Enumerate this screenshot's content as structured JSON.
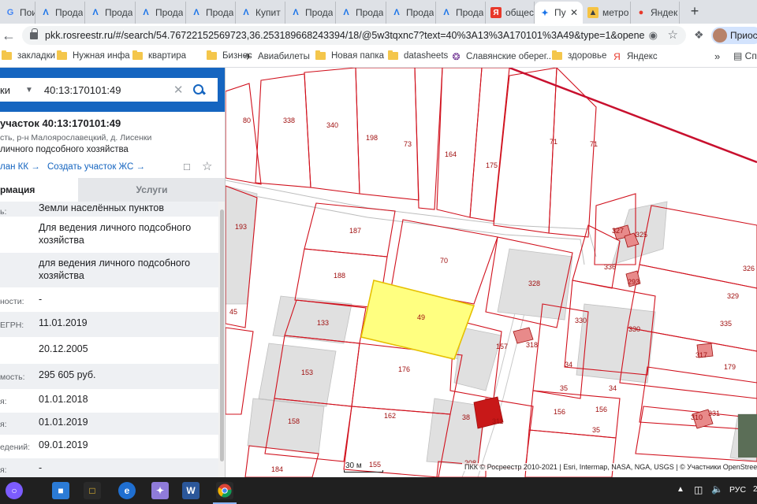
{
  "browser": {
    "tabs": [
      {
        "label": "Поиск",
        "favicon": "google-icon",
        "active": false
      },
      {
        "label": "Прода",
        "favicon": "rosreestr-icon",
        "active": false
      },
      {
        "label": "Прода",
        "favicon": "rosreestr-icon",
        "active": false
      },
      {
        "label": "Прода",
        "favicon": "rosreestr-icon",
        "active": false
      },
      {
        "label": "Прода",
        "favicon": "rosreestr-icon",
        "active": false
      },
      {
        "label": "Купит",
        "favicon": "rosreestr-icon",
        "active": false
      },
      {
        "label": "Прода",
        "favicon": "rosreestr-icon",
        "active": false
      },
      {
        "label": "Прода",
        "favicon": "rosreestr-icon",
        "active": false
      },
      {
        "label": "Прода",
        "favicon": "rosreestr-icon",
        "active": false
      },
      {
        "label": "Прода",
        "favicon": "rosreestr-icon",
        "active": false
      },
      {
        "label": "общес",
        "favicon": "yandex-icon",
        "active": false
      },
      {
        "label": "Пу",
        "favicon": "pkk-icon",
        "active": true
      },
      {
        "label": "метро",
        "favicon": "image-icon",
        "active": false
      },
      {
        "label": "Яндек",
        "favicon": "maps-pin-icon",
        "active": false
      }
    ],
    "new_tab": "+",
    "url_host": "pkk.rosreestr.ru",
    "url_rest": "/#/search/54.76722152569723,36.253189668243394/18/@5w3tqxnc7?text=40%3A13%3A170101%3A49&type=1&opened=40%...",
    "profile_label": "Приос",
    "bookmarks": [
      {
        "label": "закладки",
        "icon": "folder-icon"
      },
      {
        "label": "Нужная инфа",
        "icon": "folder-icon"
      },
      {
        "label": "квартира",
        "icon": "folder-icon"
      },
      {
        "label": "Бизнес",
        "icon": "folder-icon"
      },
      {
        "label": "Авиабилеты",
        "icon": "plane-icon"
      },
      {
        "label": "Новая папка",
        "icon": "folder-icon"
      },
      {
        "label": "datasheets",
        "icon": "folder-icon"
      },
      {
        "label": "Славянские оберег...",
        "icon": "slavic-icon"
      },
      {
        "label": "здоровье",
        "icon": "folder-icon"
      },
      {
        "label": "Яндекс",
        "icon": "yandex-icon"
      }
    ],
    "bookmarks_more": "»",
    "bookmarks_reading_list": "Сп"
  },
  "panel": {
    "search_type": "ки",
    "search_value": "40:13:170101:49",
    "title": "участок 40:13:170101:49",
    "address": "сть, р-н Малоярославецкий, д. Лисенки",
    "use": "личного подсобного хозяйства",
    "link_plan": "лан КК →",
    "link_create": "Создать участок ЖС →",
    "tab_info": "рмация",
    "tab_services": "Услуги",
    "rows": [
      {
        "key": "ь:",
        "value": "Земли населённых пунктов"
      },
      {
        "key": "",
        "value": "Для ведения личного подсобного хозяйства"
      },
      {
        "key": "",
        "value": "для ведения личного подсобного хозяйства"
      },
      {
        "key": "ности:",
        "value": "-"
      },
      {
        "key": "ЕГРН:",
        "value": "11.01.2019"
      },
      {
        "key": "",
        "value": "20.12.2005"
      },
      {
        "key": "мость:",
        "value": "295 605 руб."
      },
      {
        "key": "я:",
        "value": "01.01.2018"
      },
      {
        "key": "я:",
        "value": "01.01.2019"
      },
      {
        "key": "едений:",
        "value": "09.01.2019"
      },
      {
        "key": "я:",
        "value": "-"
      }
    ]
  },
  "map": {
    "plot_labels": [
      "80",
      "338",
      "340",
      "198",
      "73",
      "164",
      "175",
      "71",
      "71",
      "193",
      "187",
      "70",
      "327",
      "325",
      "336",
      "293",
      "326",
      "188",
      "328",
      "329",
      "45",
      "133",
      "49",
      "330",
      "330",
      "335",
      "157",
      "318",
      "317",
      "34",
      "179",
      "153",
      "176",
      "34",
      "35",
      "38",
      "311",
      "156",
      "35",
      "156",
      "310",
      "331",
      "158",
      "162",
      "208",
      "155",
      "184"
    ],
    "selected_plot": "49",
    "scale_label": "30 м",
    "attribution": "ПКК © Росреестр 2010-2021 | Esri, Intermap, NASA, NGA, USGS | © Участники OpenStreetMap",
    "colors": {
      "boundary": "#d0101c",
      "selected_fill": "#ffff80",
      "building": "#e0e0e0",
      "owned_building": "#e88a8a"
    }
  },
  "taskbar": {
    "apps": [
      "cortana",
      "store",
      "edge",
      "photos",
      "word",
      "chrome"
    ],
    "lang": "РУС",
    "clock": "2"
  }
}
